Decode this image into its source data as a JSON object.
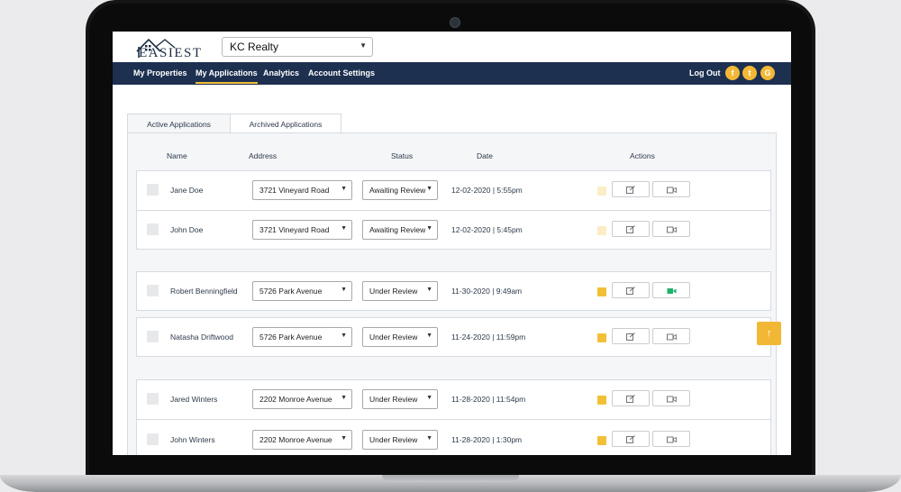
{
  "header": {
    "logo_text": "EASIEST",
    "company_select": "KC Realty"
  },
  "nav": {
    "items": [
      "My Properties",
      "My Applications",
      "Analytics",
      "Account Settings"
    ],
    "active": "My Applications",
    "logout": "Log Out",
    "social": [
      {
        "name": "facebook-icon",
        "glyph": "f"
      },
      {
        "name": "twitter-icon",
        "glyph": "t"
      },
      {
        "name": "google-icon",
        "glyph": "G"
      }
    ]
  },
  "tabs": [
    "Active Applications",
    "Archived Applications"
  ],
  "columns": {
    "name": "Name",
    "address": "Address",
    "status": "Status",
    "date": "Date",
    "actions": "Actions"
  },
  "applications": [
    {
      "name": "Jane Doe",
      "address": "3721 Vineyard Road",
      "status": "Awaiting Review",
      "date": "12-02-2020 | 5:55pm",
      "note_active": false,
      "video_active": false
    },
    {
      "name": "John Doe",
      "address": "3721 Vineyard Road",
      "status": "Awaiting Review",
      "date": "12-02-2020 | 5:45pm",
      "note_active": false,
      "video_active": false
    },
    {
      "name": "Robert Benningfield",
      "address": "5726 Park Avenue",
      "status": "Under Review",
      "date": "11-30-2020 | 9:49am",
      "note_active": true,
      "video_active": true
    },
    {
      "name": "Natasha Driftwood",
      "address": "5726 Park Avenue",
      "status": "Under Review",
      "date": "11-24-2020 | 11:59pm",
      "note_active": true,
      "video_active": false
    },
    {
      "name": "Jared Winters",
      "address": "2202 Monroe Avenue",
      "status": "Under Review",
      "date": "11-28-2020 | 11:54pm",
      "note_active": true,
      "video_active": false
    },
    {
      "name": "John Winters",
      "address": "2202 Monroe Avenue",
      "status": "Under Review",
      "date": "11-28-2020 | 1:30pm",
      "note_active": true,
      "video_active": false
    }
  ],
  "colors": {
    "nav_bg": "#1d3050",
    "accent": "#f2c037",
    "video_active": "#1eb36b"
  }
}
